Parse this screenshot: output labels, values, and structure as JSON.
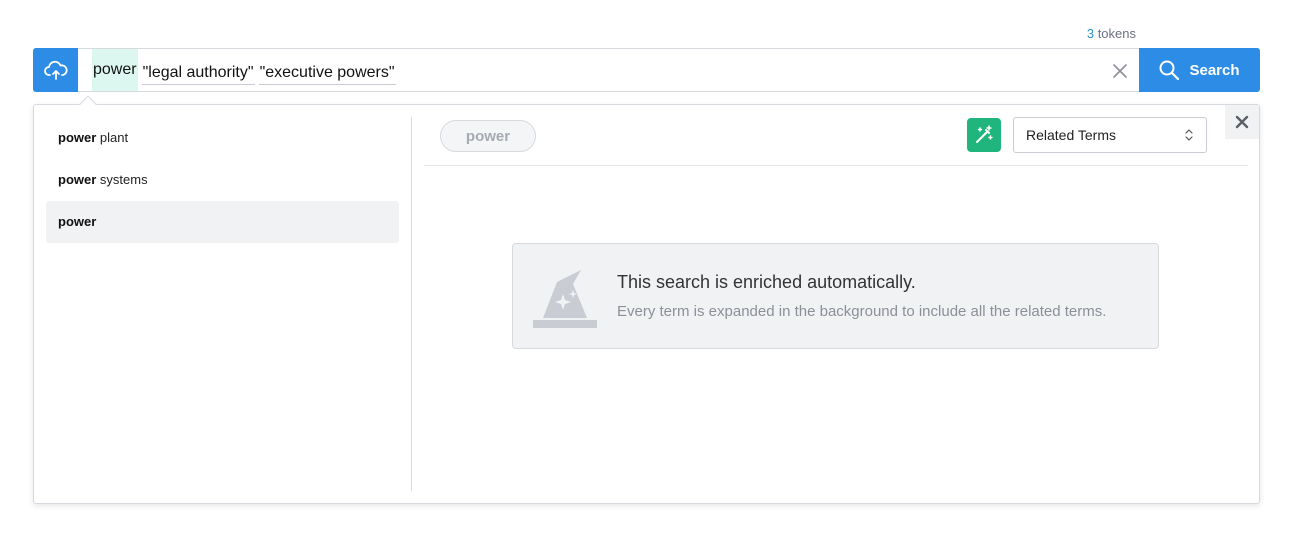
{
  "tokens": {
    "count": "3",
    "label": "tokens"
  },
  "search": {
    "tokens": [
      {
        "text": "power",
        "kind": "active"
      },
      {
        "text": "\"legal authority\"",
        "kind": "quoted"
      },
      {
        "text": "\"executive powers\"",
        "kind": "quoted"
      }
    ],
    "button_label": "Search"
  },
  "suggestions": [
    {
      "bold": "power",
      "rest": " plant"
    },
    {
      "bold": "power",
      "rest": " systems"
    },
    {
      "bold": "power",
      "rest": ""
    }
  ],
  "panel": {
    "term_pill": "power",
    "mode_select": "Related Terms",
    "info_title": "This search is enriched automatically.",
    "info_text": "Every term is expanded in the background to include all the related terms."
  },
  "colors": {
    "accent": "#2d8ce6",
    "magic": "#1fb57c",
    "active_token_bg": "#dcf7ef"
  },
  "icons": [
    "cloud-upload-icon",
    "clear-icon",
    "search-icon",
    "magic-wand-icon",
    "chevron-updown-icon",
    "close-icon",
    "wizard-hat-icon"
  ]
}
